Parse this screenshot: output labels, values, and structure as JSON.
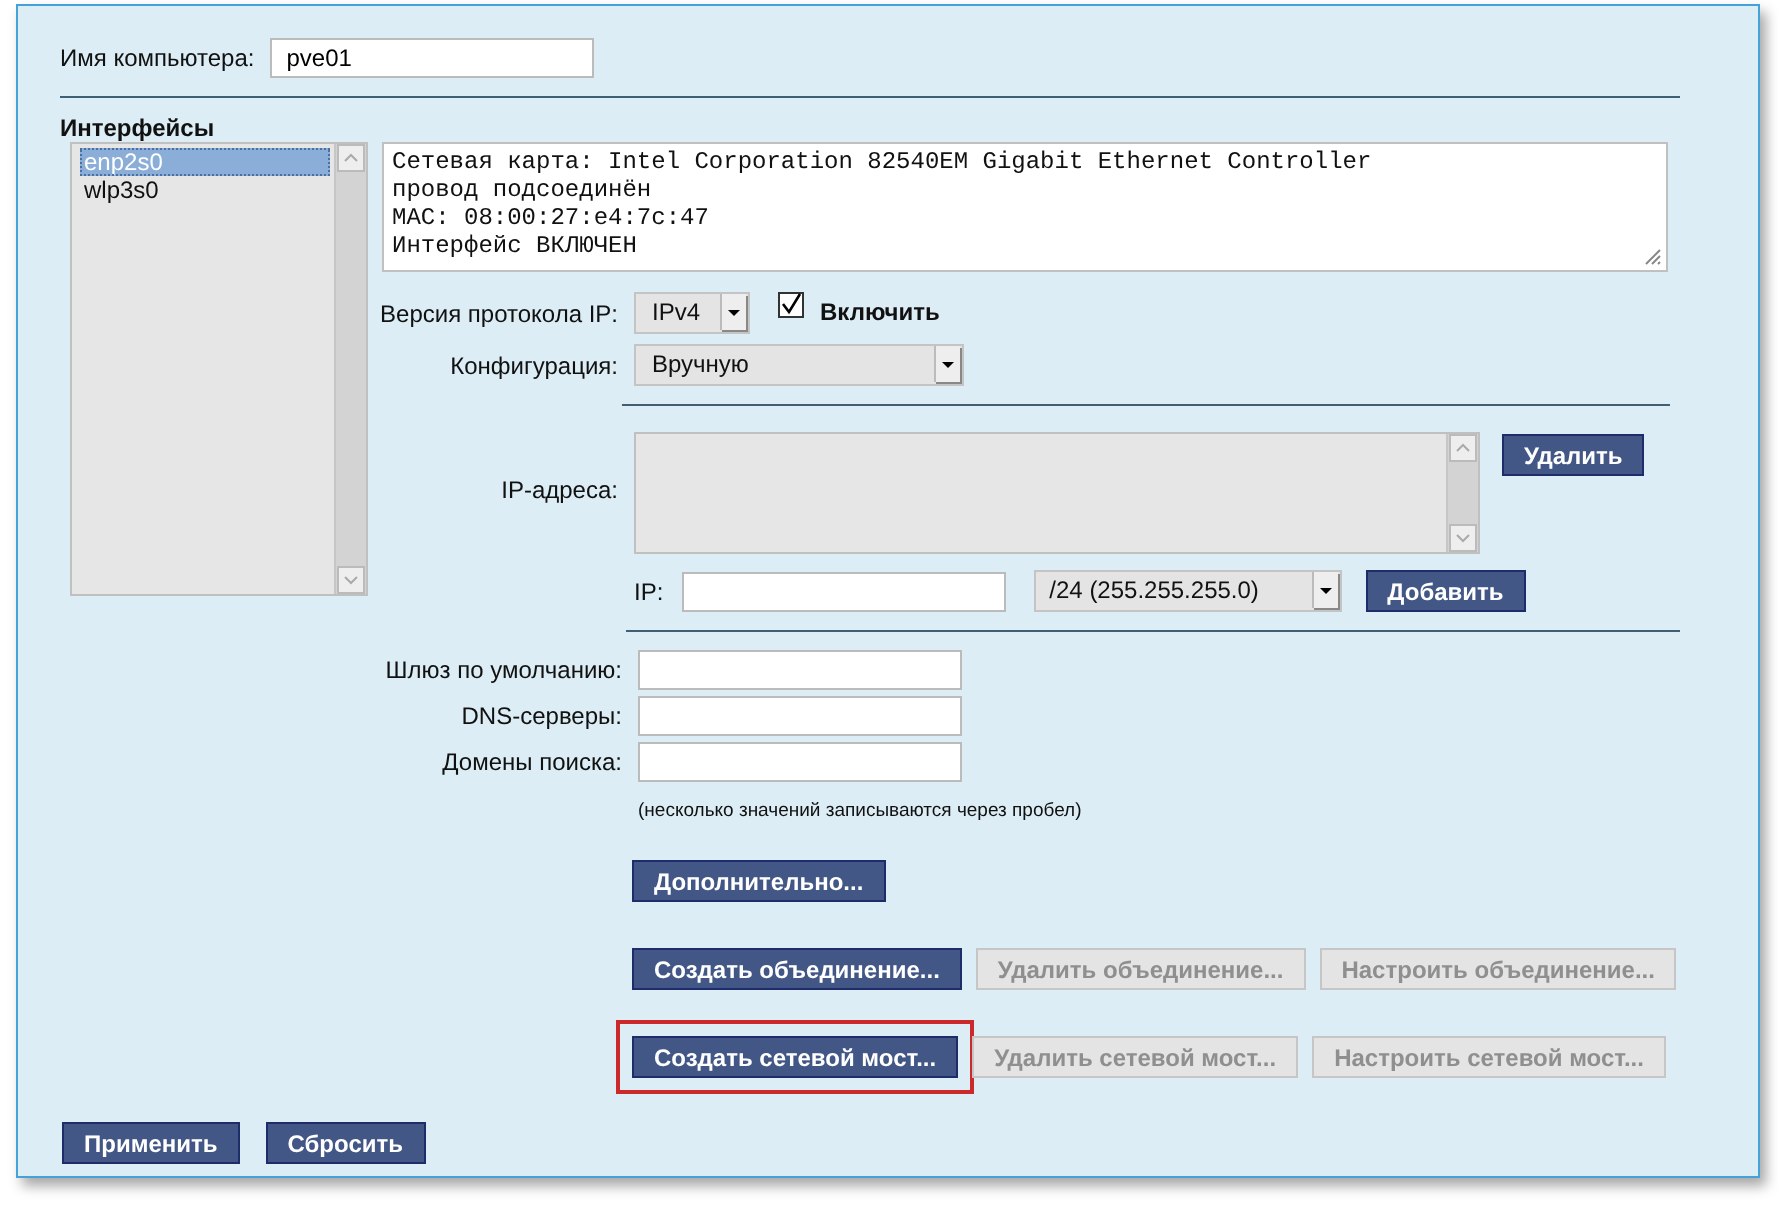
{
  "hostname": {
    "label": "Имя компьютера:",
    "value": "pve01"
  },
  "interfaces": {
    "title": "Интерфейсы",
    "items": [
      {
        "name": "enp2s0",
        "selected": true
      },
      {
        "name": "wlp3s0",
        "selected": false
      }
    ]
  },
  "info_lines": [
    "Сетевая карта: Intel Corporation 82540EM Gigabit Ethernet Controller",
    "провод подсоединён",
    "MAC: 08:00:27:e4:7c:47",
    "Интерфейс ВКЛЮЧЕН"
  ],
  "ip_version": {
    "label": "Версия протокола IP:",
    "value": "IPv4"
  },
  "enable": {
    "label": "Включить",
    "checked": true
  },
  "configuration": {
    "label": "Конфигурация:",
    "value": "Вручную"
  },
  "ip_addresses": {
    "label": "IP-адреса:",
    "delete_button": "Удалить"
  },
  "ip_entry": {
    "label": "IP:",
    "mask": "/24 (255.255.255.0)",
    "add_button": "Добавить"
  },
  "fields": [
    {
      "label": "Шлюз по умолчанию:"
    },
    {
      "label": "DNS-серверы:"
    },
    {
      "label": "Домены поиска:"
    }
  ],
  "hint": "(несколько значений записываются через пробел)",
  "advanced_button": "Дополнительно...",
  "button_rows": [
    [
      {
        "label": "Создать объединение...",
        "disabled": false,
        "highlighted": false
      },
      {
        "label": "Удалить объединение...",
        "disabled": true,
        "highlighted": false
      },
      {
        "label": "Настроить объединение...",
        "disabled": true,
        "highlighted": false
      }
    ],
    [
      {
        "label": "Создать сетевой мост...",
        "disabled": false,
        "highlighted": true
      },
      {
        "label": "Удалить сетевой мост...",
        "disabled": true,
        "highlighted": false
      },
      {
        "label": "Настроить сетевой мост...",
        "disabled": true,
        "highlighted": false
      }
    ]
  ],
  "footer_buttons": [
    "Применить",
    "Сбросить"
  ]
}
